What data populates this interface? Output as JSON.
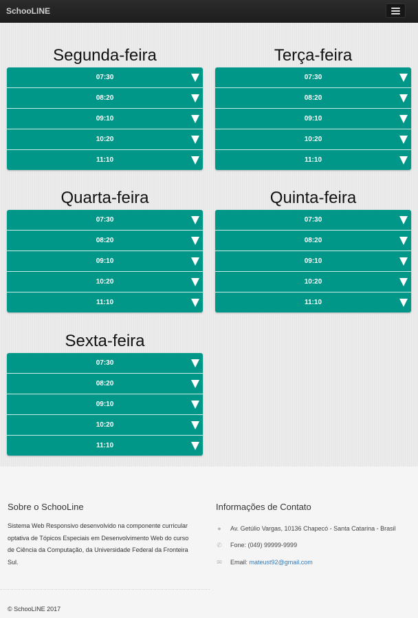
{
  "navbar": {
    "brand": "SchooLINE",
    "menu_icon": "hamburger-menu-icon"
  },
  "days": [
    {
      "name": "Segunda-feira",
      "slots": [
        "07:30",
        "08:20",
        "09:10",
        "10:20",
        "11:10"
      ]
    },
    {
      "name": "Terça-feira",
      "slots": [
        "07:30",
        "08:20",
        "09:10",
        "10:20",
        "11:10"
      ]
    },
    {
      "name": "Quarta-feira",
      "slots": [
        "07:30",
        "08:20",
        "09:10",
        "10:20",
        "11:10"
      ]
    },
    {
      "name": "Quinta-feira",
      "slots": [
        "07:30",
        "08:20",
        "09:10",
        "10:20",
        "11:10"
      ]
    },
    {
      "name": "Sexta-feira",
      "slots": [
        "07:30",
        "08:20",
        "09:10",
        "10:20",
        "11:10"
      ]
    }
  ],
  "slot_icon": "caret-down-icon",
  "footer": {
    "about_title": "Sobre o SchooLine",
    "about_text": "Sistema Web Responsivo desenvolvido na componente curricular optativa de Tópicos Especiais em Desenvolvimento Web do curso de Ciência da Computação, da Universidade Federal da Fronteira Sul.",
    "contact_title": "Informações de Contato",
    "address": "Av. Getúlio Vargas, 10136 Chapecó - Santa Catarina - Brasil",
    "phone": "Fone: (049) 99999-9999",
    "email_label": "Email:",
    "email": "mateust92@gmail.com",
    "copyright": "© SchooLINE 2017"
  },
  "colors": {
    "slot_background": "#009688",
    "navbar_background": "#222222",
    "link": "#337ab7"
  }
}
